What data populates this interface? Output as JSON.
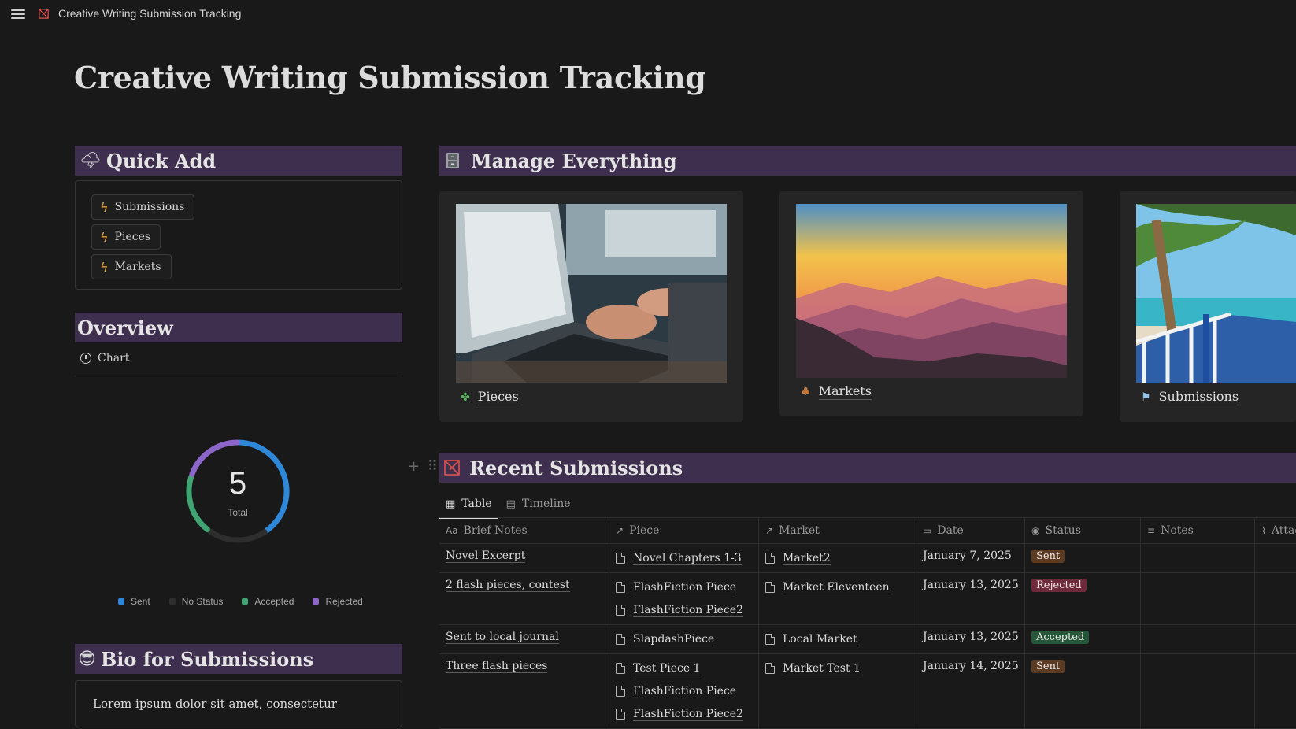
{
  "topbar": {
    "title": "Creative Writing Submission Tracking"
  },
  "page": {
    "title": "Creative Writing Submission Tracking"
  },
  "quick_add": {
    "title": "Quick Add",
    "buttons": [
      "Submissions",
      "Pieces",
      "Markets"
    ]
  },
  "overview": {
    "title": "Overview",
    "tab_label": "Chart",
    "total": "5",
    "total_label": "Total"
  },
  "chart_data": {
    "type": "pie",
    "categories": [
      "Sent",
      "No Status",
      "Accepted",
      "Rejected"
    ],
    "values": [
      2,
      1,
      1,
      1
    ],
    "colors": [
      "#2f87d8",
      "#2e2e2e",
      "#3fa372",
      "#8d66c9"
    ],
    "legend": "bottom"
  },
  "bio": {
    "title": "Bio for Submissions",
    "text": "Lorem ipsum dolor sit amet, consectetur"
  },
  "manage": {
    "title": "Manage Everything",
    "cards": [
      {
        "label": "Pieces",
        "icon": "puzzle-icon"
      },
      {
        "label": "Markets",
        "icon": "potted-plant-icon"
      },
      {
        "label": "Submissions",
        "icon": "beach-flag-icon"
      }
    ]
  },
  "recent": {
    "title": "Recent Submissions",
    "views": [
      "Table",
      "Timeline"
    ],
    "columns": [
      "Brief Notes",
      "Piece",
      "Market",
      "Date",
      "Status",
      "Notes",
      "Attachments"
    ],
    "rows": [
      {
        "notes": "Novel Excerpt",
        "pieces": [
          "Novel Chapters 1-3"
        ],
        "market": "Market2",
        "date": "January 7, 2025",
        "status": "Sent"
      },
      {
        "notes": "2 flash pieces, contest",
        "pieces": [
          "FlashFiction Piece",
          "FlashFiction Piece2"
        ],
        "market": "Market Eleventeen",
        "date": "January 13, 2025",
        "status": "Rejected"
      },
      {
        "notes": "Sent to local journal",
        "pieces": [
          "SlapdashPiece"
        ],
        "market": "Local Market",
        "date": "January 13, 2025",
        "status": "Accepted"
      },
      {
        "notes": "Three flash pieces",
        "pieces": [
          "Test Piece 1",
          "FlashFiction Piece",
          "FlashFiction Piece2"
        ],
        "market": "Market Test 1",
        "date": "January 14, 2025",
        "status": "Sent"
      }
    ]
  },
  "colors": {
    "background": "#191919",
    "section_header": "#3e2f4e",
    "status_sent": "#5c3b23",
    "status_rejected": "#6e2a3a",
    "status_accepted": "#25573b"
  }
}
